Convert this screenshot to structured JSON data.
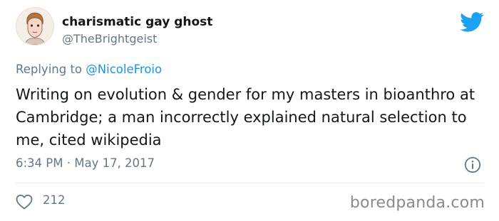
{
  "user": {
    "display_name": "charismatic gay ghost",
    "handle": "@TheBrightgeist"
  },
  "reply": {
    "prefix": "Replying to ",
    "mention": "@NicoleFroio"
  },
  "tweet": {
    "text": "Writing on evolution & gender for my masters in bioanthro at Cambridge; a man incorrectly explained natural selection to me, cited wikipedia",
    "timestamp": "6:34 PM · May 17, 2017"
  },
  "stats": {
    "likes": "212"
  },
  "watermark": "boredpanda.com",
  "colors": {
    "twitter_blue": "#1da1f2",
    "mention_blue": "#1b95e0",
    "muted_gray": "#657786",
    "text": "#14171a"
  },
  "icons": {
    "brand": "twitter-bird-icon",
    "info": "info-icon",
    "like": "heart-icon"
  }
}
